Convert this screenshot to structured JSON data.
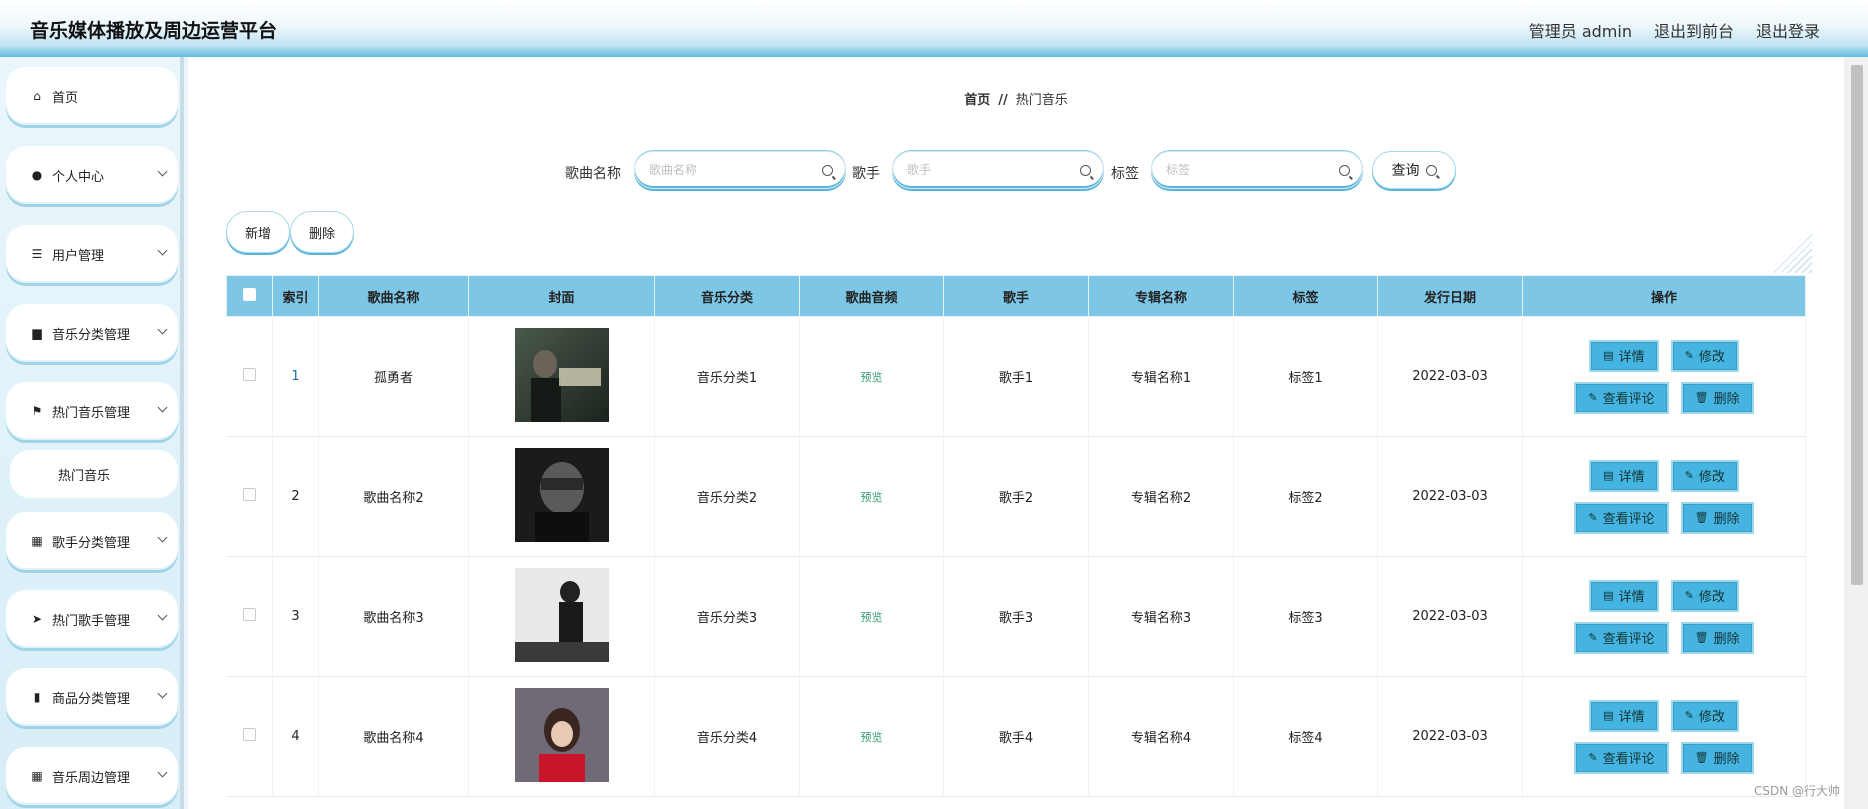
{
  "header": {
    "title": "音乐媒体播放及周边运营平台",
    "admin": "管理员 admin",
    "to_front": "退出到前台",
    "logout": "退出登录"
  },
  "sidebar": {
    "items": [
      {
        "label": "首页",
        "icon": "home-icon",
        "glyph": "⌂"
      },
      {
        "label": "个人中心",
        "icon": "user-icon",
        "glyph": "●"
      },
      {
        "label": "用户管理",
        "icon": "list-icon",
        "glyph": "☰"
      },
      {
        "label": "音乐分类管理",
        "icon": "box-icon",
        "glyph": "▆"
      },
      {
        "label": "热门音乐管理",
        "icon": "flag-icon",
        "glyph": "⚑"
      },
      {
        "label": "歌手分类管理",
        "icon": "grid-icon",
        "glyph": "▦"
      },
      {
        "label": "热门歌手管理",
        "icon": "send-icon",
        "glyph": "➤"
      },
      {
        "label": "商品分类管理",
        "icon": "book-icon",
        "glyph": "▮"
      },
      {
        "label": "音乐周边管理",
        "icon": "grid-icon",
        "glyph": "▦"
      }
    ],
    "sub_item": "热门音乐"
  },
  "breadcrumb": {
    "home": "首页",
    "sep": "//",
    "current": "热门音乐"
  },
  "search": {
    "song_label": "歌曲名称",
    "song_placeholder": "歌曲名称",
    "singer_label": "歌手",
    "singer_placeholder": "歌手",
    "tag_label": "标签",
    "tag_placeholder": "标签",
    "query": "查询"
  },
  "actions": {
    "add": "新增",
    "delete": "删除"
  },
  "table": {
    "headers": [
      "索引",
      "歌曲名称",
      "封面",
      "音乐分类",
      "歌曲音频",
      "歌手",
      "专辑名称",
      "标签",
      "发行日期",
      "操作"
    ],
    "rows": [
      {
        "index": "1",
        "song": "孤勇者",
        "category": "音乐分类1",
        "audio": "预览",
        "singer": "歌手1",
        "album": "专辑名称1",
        "tag": "标签1",
        "date": "2022-03-03"
      },
      {
        "index": "2",
        "song": "歌曲名称2",
        "category": "音乐分类2",
        "audio": "预览",
        "singer": "歌手2",
        "album": "专辑名称2",
        "tag": "标签2",
        "date": "2022-03-03"
      },
      {
        "index": "3",
        "song": "歌曲名称3",
        "category": "音乐分类3",
        "audio": "预览",
        "singer": "歌手3",
        "album": "专辑名称3",
        "tag": "标签3",
        "date": "2022-03-03"
      },
      {
        "index": "4",
        "song": "歌曲名称4",
        "category": "音乐分类4",
        "audio": "预览",
        "singer": "歌手4",
        "album": "专辑名称4",
        "tag": "标签4",
        "date": "2022-03-03"
      }
    ],
    "ops": {
      "detail": "详情",
      "edit": "修改",
      "comments": "查看评论",
      "delete": "删除"
    }
  },
  "watermark": "CSDN @行大帅",
  "colors": {
    "accent": "#45b4e0",
    "header_bg": "#7dc6e6",
    "preview": "#2e9d6d"
  }
}
